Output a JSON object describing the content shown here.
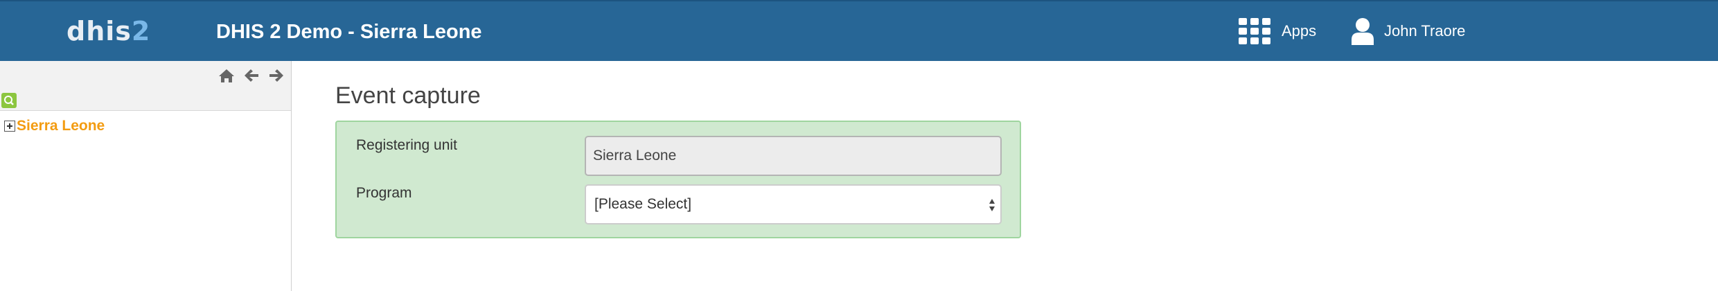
{
  "header": {
    "logo_main": "dhis",
    "logo_num": "2",
    "title": "DHIS 2 Demo - Sierra Leone",
    "apps_label": "Apps",
    "user_name": "John Traore"
  },
  "sidebar": {
    "nav_icons": [
      "home-icon",
      "arrow-left-icon",
      "arrow-right-icon"
    ],
    "search_icon": "search-icon",
    "tree": [
      {
        "label": "Sierra Leone",
        "expandable": true
      }
    ]
  },
  "main": {
    "page_title": "Event capture",
    "form": {
      "registering_unit_label": "Registering unit",
      "registering_unit_value": "Sierra Leone",
      "program_label": "Program",
      "program_value": "[Please Select]"
    }
  },
  "colors": {
    "header_bg": "#276696",
    "tree_link": "#f39c12",
    "form_bg": "#d0e9d0",
    "form_border": "#9fd59f",
    "search_btn": "#8cc63f"
  }
}
